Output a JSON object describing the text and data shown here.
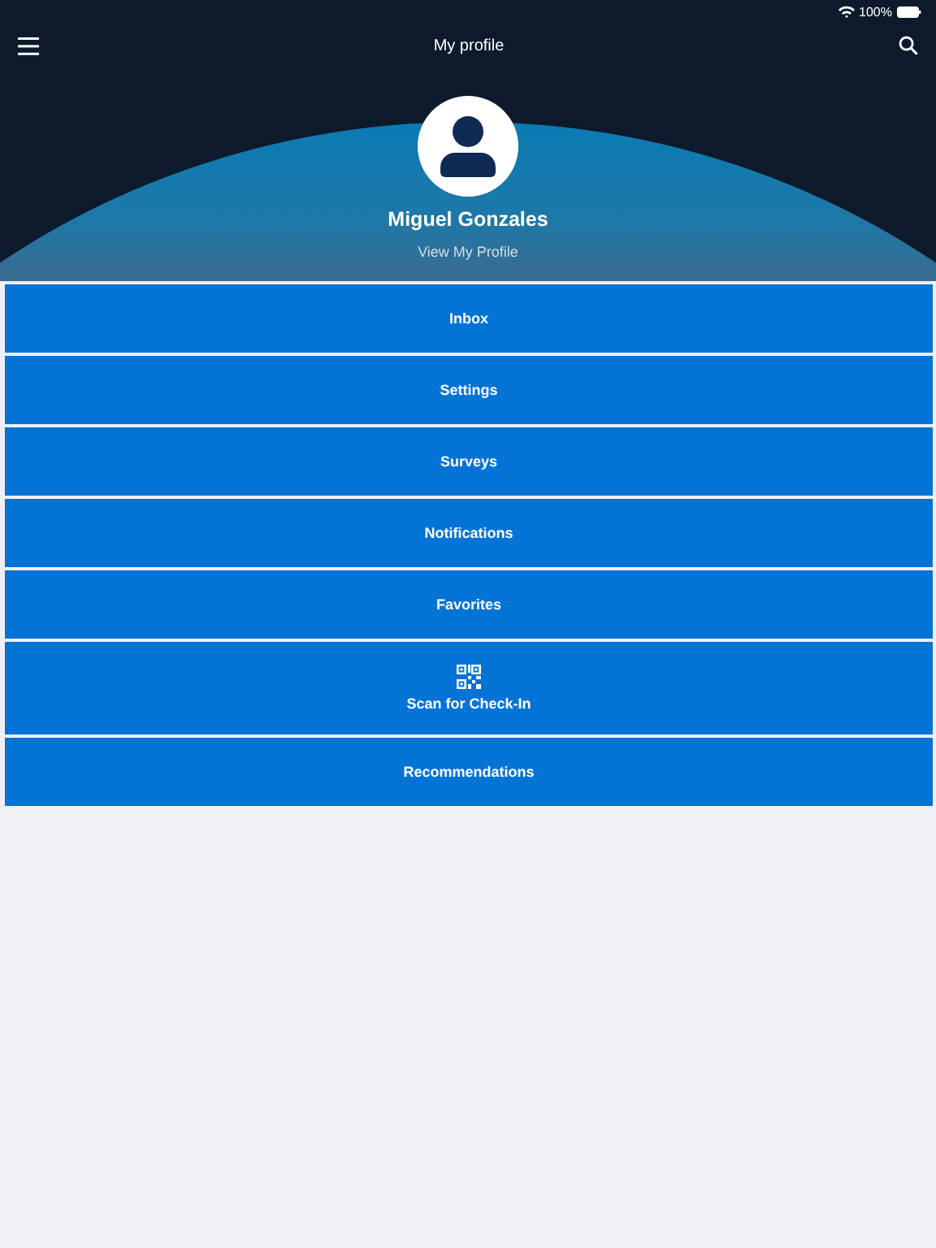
{
  "status_bar": {
    "battery": "100%"
  },
  "nav_bar": {
    "title": "My profile"
  },
  "profile": {
    "name": "Miguel Gonzales",
    "link": "View My Profile"
  },
  "menu": [
    {
      "label": "Inbox",
      "kind": "text"
    },
    {
      "label": "Settings",
      "kind": "text"
    },
    {
      "label": "Surveys",
      "kind": "text"
    },
    {
      "label": "Notifications",
      "kind": "text"
    },
    {
      "label": "Favorites",
      "kind": "text"
    },
    {
      "label": "Scan for Check-In",
      "kind": "qr"
    },
    {
      "label": "Recommendations",
      "kind": "text"
    }
  ]
}
